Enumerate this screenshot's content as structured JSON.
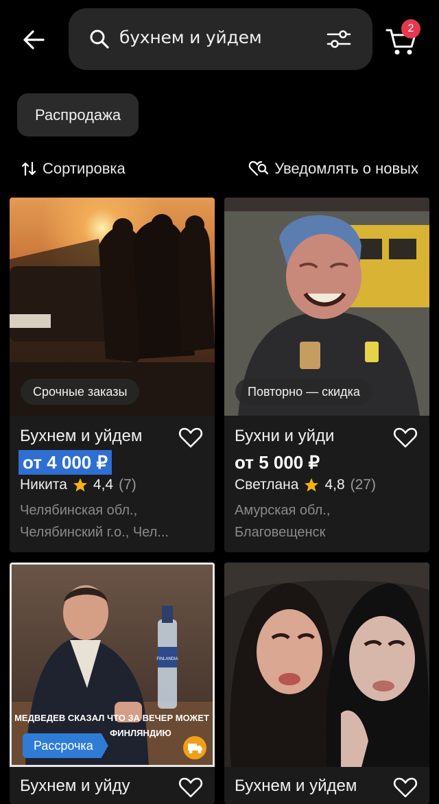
{
  "header": {
    "search_value": "бухнем и уйдем",
    "cart_count": "2"
  },
  "filters": {
    "chip_label": "Распродажа"
  },
  "sort": {
    "sort_label": "Сортировка",
    "notify_label": "Уведомлять о новых"
  },
  "cards": [
    {
      "badge": "Срочные заказы",
      "title": "Бухнем и уйдем",
      "price": "от 4 000 ₽",
      "seller": "Никита",
      "rating": "4,4",
      "reviews": "(7)",
      "location_line1": "Челябинская обл.,",
      "location_line2": "Челябинский г.о., Чел..."
    },
    {
      "badge": "Повторно — скидка",
      "title": "Бухни и уйди",
      "price": "от 5 000 ₽",
      "seller": "Светлана",
      "rating": "4,8",
      "reviews": "(27)",
      "location_line1": "Амурская обл.,",
      "location_line2": "Благовещенск"
    },
    {
      "installment": "Рассрочка",
      "image_caption_line1": "МЕДВЕДЕВ СКАЗАЛ ЧТО ЗА ВЕЧЕР МОЖЕТ",
      "image_caption_line2": "ФИНЛЯНДИЮ",
      "bottle_label": "FINLANDIA",
      "title": "Бухнем и уйду"
    },
    {
      "title": "Бухнем и уйдем"
    }
  ],
  "colors": {
    "background": "#000000",
    "card": "#1b1b1b",
    "accent_blue": "#2f6fd1",
    "badge_red": "#e53950",
    "star": "#f5b50a"
  }
}
